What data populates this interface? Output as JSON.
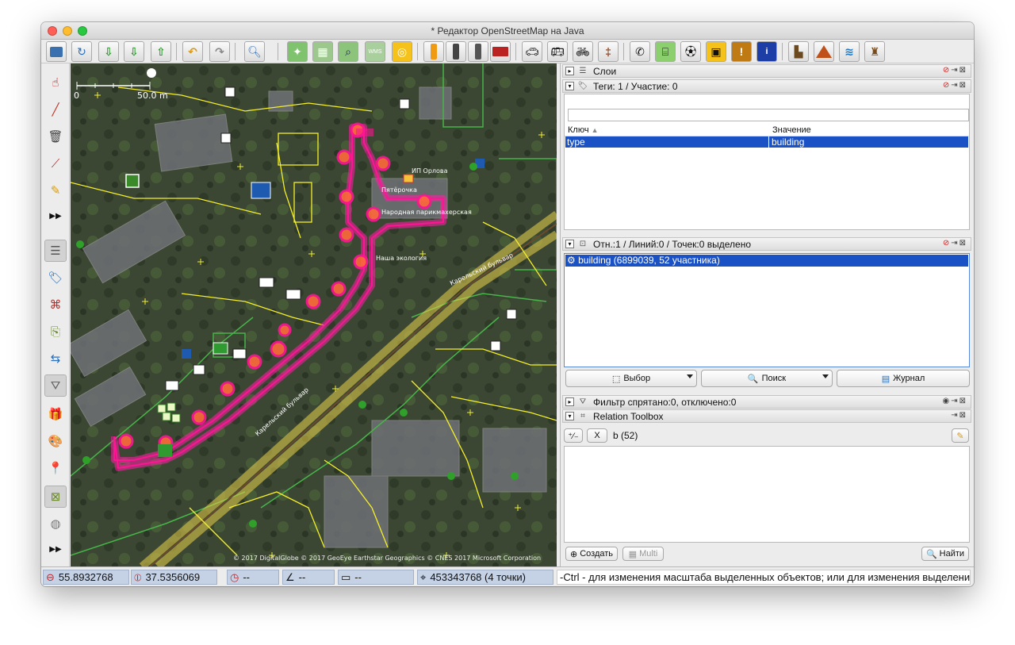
{
  "window": {
    "title": "* Редактор OpenStreetMap на Java"
  },
  "toolbar": {
    "icons": [
      "open-icon",
      "open-location-icon",
      "download-icon",
      "download-along-icon",
      "upload-icon",
      "undo-icon",
      "redo-icon",
      "preferences-icon",
      "wireframe-icon",
      "imagery-icon",
      "zoom-icon",
      "tms-icon",
      "reload-icon",
      "traffic-signals-icon",
      "railway-crossing-icon",
      "signal-icon",
      "barrier-wall-icon",
      "car-icon",
      "bus-icon",
      "bicycle-icon",
      "railway-icon",
      "phone-icon",
      "sport-field-icon",
      "football-icon",
      "shop-icon",
      "warning-icon",
      "information-icon",
      "industrial-icon",
      "peak-icon",
      "water-icon",
      "castle-icon"
    ]
  },
  "map": {
    "scale_left": "0",
    "scale_right": "50.0 m",
    "labels": [
      "Пятёрочка",
      "Народная парикмахерская",
      "Карельский бульвар",
      "Карельский бульвар",
      "ИП Орлова",
      "Наша экология"
    ],
    "attribution": "© 2017 DigitalGlobe © 2017 GeoEye Earthstar Geographics © CNES 2017 Microsoft Corporation",
    "colors": {
      "satellite": "#3e4a33",
      "selection": "#ff1493",
      "ways": "#f5ef2a",
      "landuse": "#48b44a"
    }
  },
  "panels": {
    "layers": {
      "title": "Слои"
    },
    "tags": {
      "title": "Теги: 1 / Участие: 0",
      "col_key": "Ключ",
      "col_value": "Значение",
      "rows": [
        {
          "key": "type",
          "value": "building"
        }
      ]
    },
    "selection": {
      "title": "Отн.:1 / Линий:0 / Точек:0 выделено",
      "items": [
        "building (6899039, 52 участника)"
      ],
      "btn_select": "Выбор",
      "btn_search": "Поиск",
      "btn_history": "Журнал"
    },
    "filter": {
      "title": "Фильтр спрятано:0, отключено:0"
    },
    "relation": {
      "title": "Relation Toolbox",
      "x_label": "X",
      "relation_text": "b (52)",
      "btn_create": "Создать",
      "btn_multi": "Multi",
      "btn_find": "Найти"
    }
  },
  "status": {
    "lat": "55.8932768",
    "lon": "37.5356069",
    "heading": "--",
    "angle": "--",
    "distance": "--",
    "way_info": "453343768 (4 точки)",
    "help": "-Ctrl - для изменения масштаба выделенных объектов; или для изменения выделения"
  }
}
